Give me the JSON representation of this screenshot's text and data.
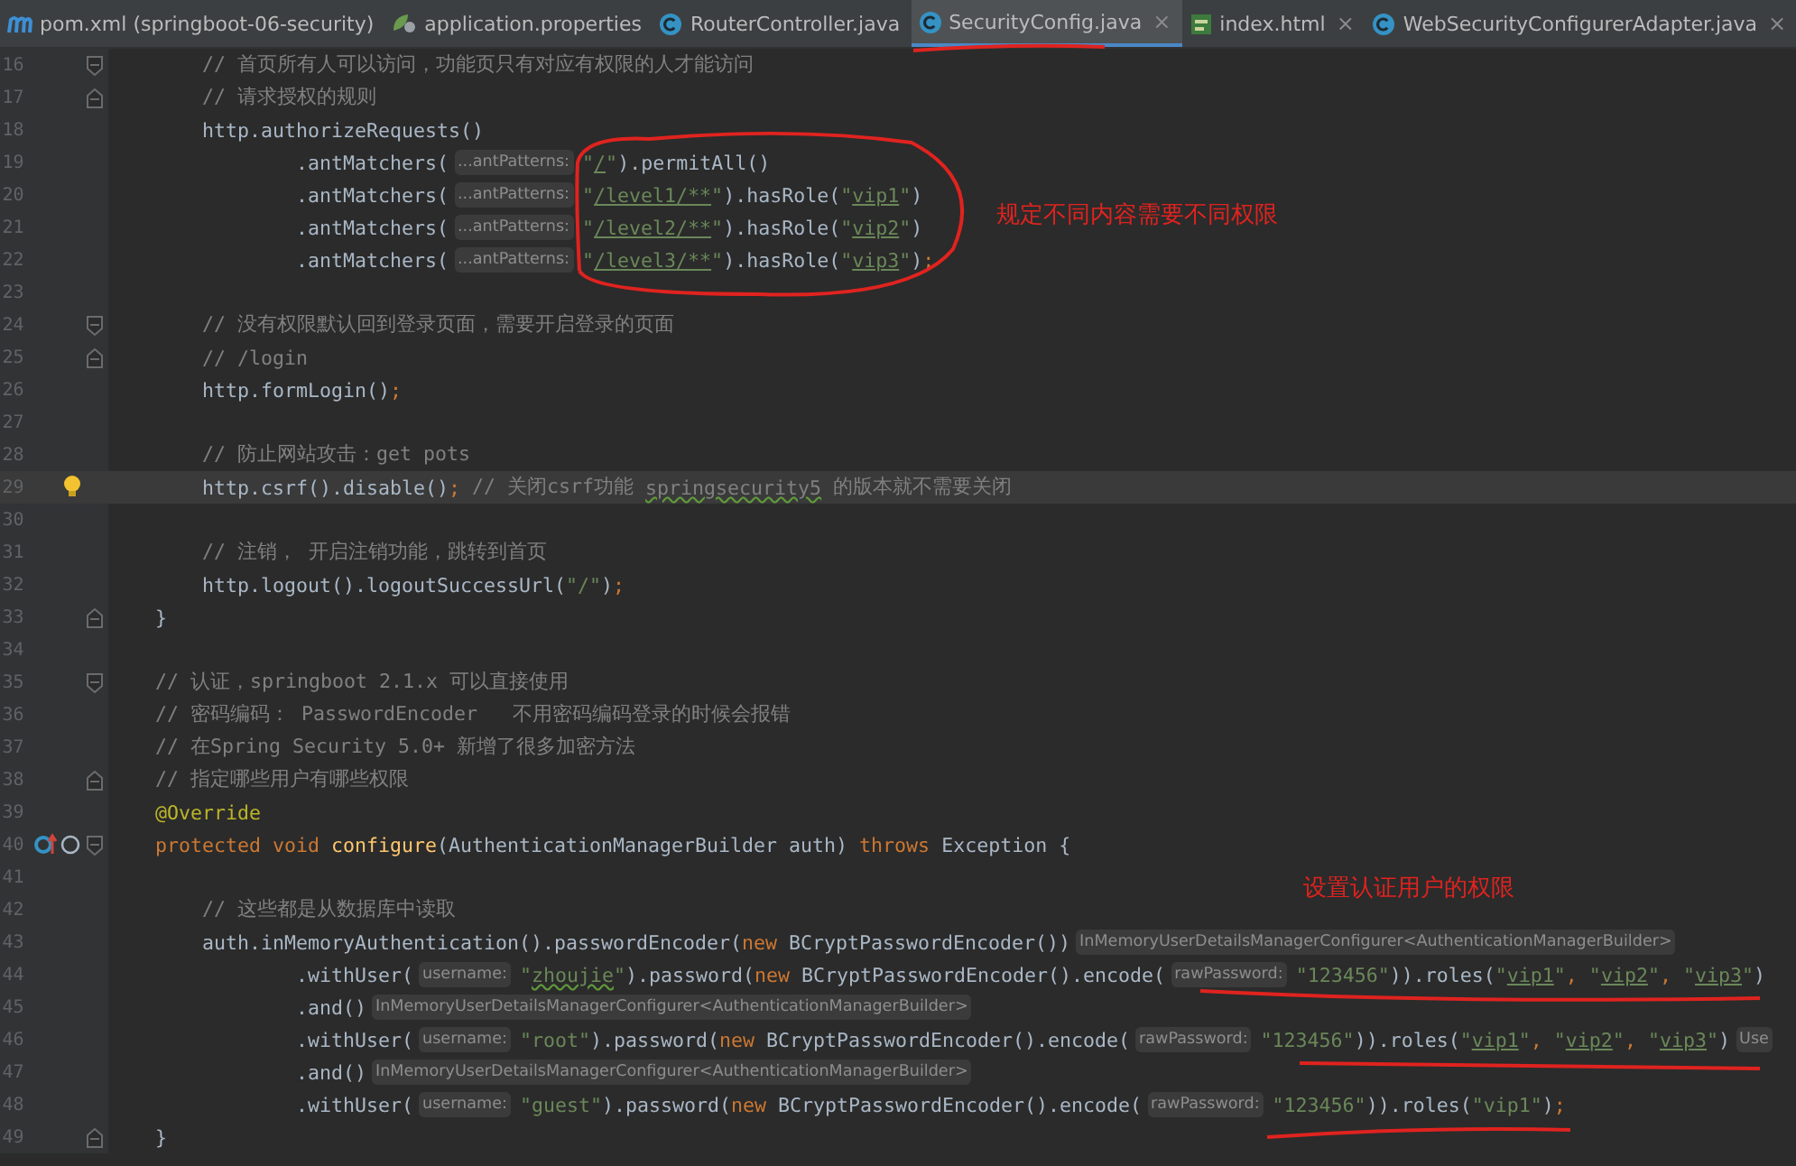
{
  "tabs": [
    {
      "label": "pom.xml (springboot-06-security)",
      "kind": "maven",
      "selected": false,
      "closable": false
    },
    {
      "label": "application.properties",
      "kind": "properties",
      "selected": false,
      "closable": false
    },
    {
      "label": "RouterController.java",
      "kind": "class",
      "selected": false,
      "closable": false
    },
    {
      "label": "SecurityConfig.java",
      "kind": "class",
      "selected": true,
      "closable": true
    },
    {
      "label": "index.html",
      "kind": "html",
      "selected": false,
      "closable": true
    },
    {
      "label": "WebSecurityConfigurerAdapter.java",
      "kind": "class",
      "selected": false,
      "closable": true
    }
  ],
  "close_glyph": "×",
  "editor": {
    "lines": [
      {
        "n": "16",
        "kind": "fold-start",
        "current": false,
        "tokens": [
          {
            "kind": "cm",
            "text": "        // 首页所有人可以访问，功能页只有对应有权限的人才能访问"
          }
        ]
      },
      {
        "n": "17",
        "kind": "fold-end",
        "current": false,
        "tokens": [
          {
            "kind": "cm",
            "text": "        // 请求授权的规则"
          }
        ]
      },
      {
        "n": "18",
        "current": false,
        "tokens": [
          {
            "kind": "p",
            "text": "        http.authorizeRequests()"
          }
        ]
      },
      {
        "n": "19",
        "current": false,
        "tokens": [
          {
            "kind": "p",
            "text": "                .antMatchers("
          },
          {
            "kind": "hint",
            "text": "...antPatterns:"
          },
          {
            "kind": "str",
            "text": "\""
          },
          {
            "kind": "link",
            "text": "/"
          },
          {
            "kind": "str",
            "text": "\""
          },
          {
            "kind": "p",
            "text": ").permitAll()"
          }
        ]
      },
      {
        "n": "20",
        "current": false,
        "tokens": [
          {
            "kind": "p",
            "text": "                .antMatchers("
          },
          {
            "kind": "hint",
            "text": "...antPatterns:"
          },
          {
            "kind": "str",
            "text": "\""
          },
          {
            "kind": "link",
            "text": "/level1/**"
          },
          {
            "kind": "str",
            "text": "\""
          },
          {
            "kind": "p",
            "text": ").hasRole("
          },
          {
            "kind": "str",
            "text": "\""
          },
          {
            "kind": "link",
            "text": "vip1"
          },
          {
            "kind": "str",
            "text": "\""
          },
          {
            "kind": "p",
            "text": ")"
          }
        ]
      },
      {
        "n": "21",
        "current": false,
        "tokens": [
          {
            "kind": "p",
            "text": "                .antMatchers("
          },
          {
            "kind": "hint",
            "text": "...antPatterns:"
          },
          {
            "kind": "str",
            "text": "\""
          },
          {
            "kind": "link",
            "text": "/level2/**"
          },
          {
            "kind": "str",
            "text": "\""
          },
          {
            "kind": "p",
            "text": ").hasRole("
          },
          {
            "kind": "str",
            "text": "\""
          },
          {
            "kind": "link",
            "text": "vip2"
          },
          {
            "kind": "str",
            "text": "\""
          },
          {
            "kind": "p",
            "text": ")"
          }
        ]
      },
      {
        "n": "22",
        "current": false,
        "tokens": [
          {
            "kind": "p",
            "text": "                .antMatchers("
          },
          {
            "kind": "hint",
            "text": "...antPatterns:"
          },
          {
            "kind": "str",
            "text": "\""
          },
          {
            "kind": "link",
            "text": "/level3/**"
          },
          {
            "kind": "str",
            "text": "\""
          },
          {
            "kind": "p",
            "text": ").hasRole("
          },
          {
            "kind": "str",
            "text": "\""
          },
          {
            "kind": "link",
            "text": "vip3"
          },
          {
            "kind": "str",
            "text": "\""
          },
          {
            "kind": "p",
            "text": ")"
          },
          {
            "kind": "kw",
            "text": ";"
          }
        ]
      },
      {
        "n": "23",
        "current": false
      },
      {
        "n": "24",
        "kind": "fold-start",
        "current": false,
        "tokens": [
          {
            "kind": "cm",
            "text": "        // 没有权限默认回到登录页面，需要开启登录的页面"
          }
        ]
      },
      {
        "n": "25",
        "kind": "fold-end",
        "current": false,
        "tokens": [
          {
            "kind": "cm",
            "text": "        // /login"
          }
        ]
      },
      {
        "n": "26",
        "current": false,
        "tokens": [
          {
            "kind": "p",
            "text": "        http.formLogin()"
          },
          {
            "kind": "kw",
            "text": ";"
          }
        ]
      },
      {
        "n": "27",
        "current": false
      },
      {
        "n": "28",
        "current": false,
        "tokens": [
          {
            "kind": "cm",
            "text": "        // 防止网站攻击：get pots"
          }
        ]
      },
      {
        "n": "29",
        "kind": "bulb",
        "current": true,
        "tokens": [
          {
            "kind": "p",
            "text": "        http.csrf().disable()"
          },
          {
            "kind": "kw",
            "text": ";"
          },
          {
            "kind": "cm",
            "text": " // 关闭csrf功能 "
          },
          {
            "kind": "cm-typo",
            "text": "springsecurity5"
          },
          {
            "kind": "cm",
            "text": " 的版本就不需要关闭"
          }
        ]
      },
      {
        "n": "30",
        "current": false
      },
      {
        "n": "31",
        "current": false,
        "tokens": [
          {
            "kind": "cm",
            "text": "        // 注销， 开启注销功能，跳转到首页"
          }
        ]
      },
      {
        "n": "32",
        "current": false,
        "tokens": [
          {
            "kind": "p",
            "text": "        http.logout().logoutSuccessUrl("
          },
          {
            "kind": "str",
            "text": "\"/\""
          },
          {
            "kind": "p",
            "text": ")"
          },
          {
            "kind": "kw",
            "text": ";"
          }
        ]
      },
      {
        "n": "33",
        "kind": "fold-end",
        "current": false,
        "tokens": [
          {
            "kind": "p",
            "text": "    }"
          }
        ]
      },
      {
        "n": "34",
        "current": false
      },
      {
        "n": "35",
        "kind": "fold-start",
        "current": false,
        "tokens": [
          {
            "kind": "cm",
            "text": "    // 认证，springboot 2.1.x 可以直接使用"
          }
        ]
      },
      {
        "n": "36",
        "current": false,
        "tokens": [
          {
            "kind": "cm",
            "text": "    // 密码编码： PasswordEncoder   不用密码编码登录的时候会报错"
          }
        ]
      },
      {
        "n": "37",
        "current": false,
        "tokens": [
          {
            "kind": "cm",
            "text": "    // 在Spring Security 5.0+ 新增了很多加密方法"
          }
        ]
      },
      {
        "n": "38",
        "kind": "fold-end",
        "current": false,
        "tokens": [
          {
            "kind": "cm",
            "text": "    // 指定哪些用户有哪些权限"
          }
        ]
      },
      {
        "n": "39",
        "current": false,
        "tokens": [
          {
            "kind": "ann",
            "text": "    @Override"
          }
        ]
      },
      {
        "n": "40",
        "kind": "override",
        "current": false,
        "tokens": [
          {
            "kind": "kw",
            "text": "    protected void "
          },
          {
            "kind": "fn",
            "text": "configure"
          },
          {
            "kind": "p",
            "text": "(AuthenticationManagerBuilder auth) "
          },
          {
            "kind": "kw",
            "text": "throws "
          },
          {
            "kind": "p",
            "text": "Exception {"
          }
        ]
      },
      {
        "n": "41",
        "current": false
      },
      {
        "n": "42",
        "current": false,
        "tokens": [
          {
            "kind": "cm",
            "text": "        // 这些都是从数据库中读取"
          }
        ]
      },
      {
        "n": "43",
        "current": false,
        "tokens": [
          {
            "kind": "p",
            "text": "        auth.inMemoryAuthentication().passwordEncoder("
          },
          {
            "kind": "kw",
            "text": "new "
          },
          {
            "kind": "p",
            "text": "BCryptPasswordEncoder())"
          },
          {
            "kind": "hint",
            "text": "InMemoryUserDetailsManagerConfigurer<AuthenticationManagerBuilder>"
          }
        ]
      },
      {
        "n": "44",
        "current": false,
        "tokens": [
          {
            "kind": "p",
            "text": "                .withUser("
          },
          {
            "kind": "hint",
            "text": "username:"
          },
          {
            "kind": "str",
            "text": "\""
          },
          {
            "kind": "str-typo",
            "text": "zhoujie"
          },
          {
            "kind": "str",
            "text": "\""
          },
          {
            "kind": "p",
            "text": ").password("
          },
          {
            "kind": "kw",
            "text": "new "
          },
          {
            "kind": "p",
            "text": "BCryptPasswordEncoder().encode("
          },
          {
            "kind": "hint",
            "text": "rawPassword:"
          },
          {
            "kind": "str",
            "text": "\"123456\""
          },
          {
            "kind": "p",
            "text": ")).roles("
          },
          {
            "kind": "str",
            "text": "\""
          },
          {
            "kind": "link",
            "text": "vip1"
          },
          {
            "kind": "str",
            "text": "\""
          },
          {
            "kind": "kw",
            "text": ", "
          },
          {
            "kind": "str",
            "text": "\""
          },
          {
            "kind": "link",
            "text": "vip2"
          },
          {
            "kind": "str",
            "text": "\""
          },
          {
            "kind": "kw",
            "text": ", "
          },
          {
            "kind": "str",
            "text": "\""
          },
          {
            "kind": "link",
            "text": "vip3"
          },
          {
            "kind": "str",
            "text": "\""
          },
          {
            "kind": "p",
            "text": ")"
          }
        ]
      },
      {
        "n": "45",
        "current": false,
        "tokens": [
          {
            "kind": "p",
            "text": "                .and()"
          },
          {
            "kind": "hint",
            "text": "InMemoryUserDetailsManagerConfigurer<AuthenticationManagerBuilder>"
          }
        ]
      },
      {
        "n": "46",
        "current": false,
        "tokens": [
          {
            "kind": "p",
            "text": "                .withUser("
          },
          {
            "kind": "hint",
            "text": "username:"
          },
          {
            "kind": "str",
            "text": "\"root\""
          },
          {
            "kind": "p",
            "text": ").password("
          },
          {
            "kind": "kw",
            "text": "new "
          },
          {
            "kind": "p",
            "text": "BCryptPasswordEncoder().encode("
          },
          {
            "kind": "hint",
            "text": "rawPassword:"
          },
          {
            "kind": "str",
            "text": "\"123456\""
          },
          {
            "kind": "p",
            "text": ")).roles("
          },
          {
            "kind": "str",
            "text": "\""
          },
          {
            "kind": "link",
            "text": "vip1"
          },
          {
            "kind": "str",
            "text": "\""
          },
          {
            "kind": "kw",
            "text": ", "
          },
          {
            "kind": "str",
            "text": "\""
          },
          {
            "kind": "link",
            "text": "vip2"
          },
          {
            "kind": "str",
            "text": "\""
          },
          {
            "kind": "kw",
            "text": ", "
          },
          {
            "kind": "str",
            "text": "\""
          },
          {
            "kind": "link",
            "text": "vip3"
          },
          {
            "kind": "str",
            "text": "\""
          },
          {
            "kind": "p",
            "text": ")"
          },
          {
            "kind": "hint",
            "text": "Use"
          }
        ]
      },
      {
        "n": "47",
        "current": false,
        "tokens": [
          {
            "kind": "p",
            "text": "                .and()"
          },
          {
            "kind": "hint",
            "text": "InMemoryUserDetailsManagerConfigurer<AuthenticationManagerBuilder>"
          }
        ]
      },
      {
        "n": "48",
        "current": false,
        "tokens": [
          {
            "kind": "p",
            "text": "                .withUser("
          },
          {
            "kind": "hint",
            "text": "username:"
          },
          {
            "kind": "str",
            "text": "\"guest\""
          },
          {
            "kind": "p",
            "text": ").password("
          },
          {
            "kind": "kw",
            "text": "new "
          },
          {
            "kind": "p",
            "text": "BCryptPasswordEncoder().encode("
          },
          {
            "kind": "hint",
            "text": "rawPassword:"
          },
          {
            "kind": "str",
            "text": "\"123456\""
          },
          {
            "kind": "p",
            "text": ")).roles("
          },
          {
            "kind": "str",
            "text": "\"vip1\""
          },
          {
            "kind": "p",
            "text": ")"
          },
          {
            "kind": "kw",
            "text": ";"
          }
        ]
      },
      {
        "n": "49",
        "kind": "fold-end",
        "current": false,
        "tokens": [
          {
            "kind": "p",
            "text": "    }"
          }
        ]
      }
    ]
  },
  "annotations": [
    {
      "text": "规定不同内容需要不同权限"
    },
    {
      "text": "设置认证用户的权限"
    }
  ]
}
